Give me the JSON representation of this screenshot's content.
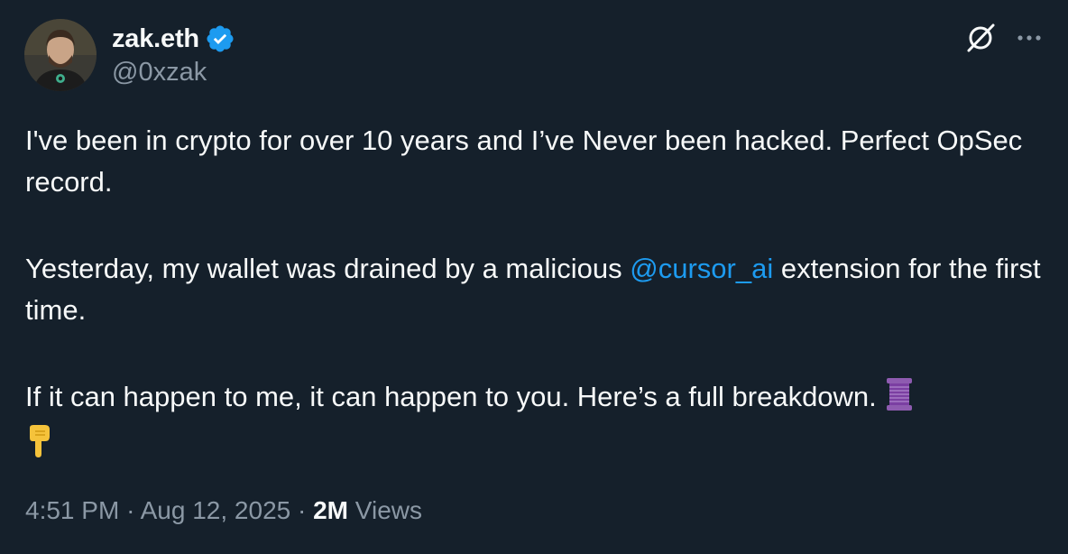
{
  "author": {
    "display_name": "zak.eth",
    "handle": "@0xzak",
    "verified": true
  },
  "tweet": {
    "para1": "I've been in crypto for over 10 years and I’ve Never been hacked. Perfect OpSec record.",
    "para2_before": "Yesterday, my wallet was drained by a malicious ",
    "para2_mention": "@cursor_ai",
    "para2_after": " extension for the first time.",
    "para3": "If it can happen to me, it can happen to you. Here’s a full breakdown.",
    "emojis": [
      "thread-spool-emoji",
      "pointing-down-emoji"
    ]
  },
  "meta": {
    "time": "4:51 PM",
    "separator": "·",
    "date": "Aug 12, 2025",
    "views_count": "2M",
    "views_label": "Views"
  },
  "colors": {
    "background": "#15202b",
    "text": "#f7f9f9",
    "secondary": "#8b98a5",
    "accent": "#1d9bf0"
  },
  "icons": {
    "verified": "verified-badge-icon",
    "grok": "grok-icon",
    "more": "more-options-icon"
  }
}
